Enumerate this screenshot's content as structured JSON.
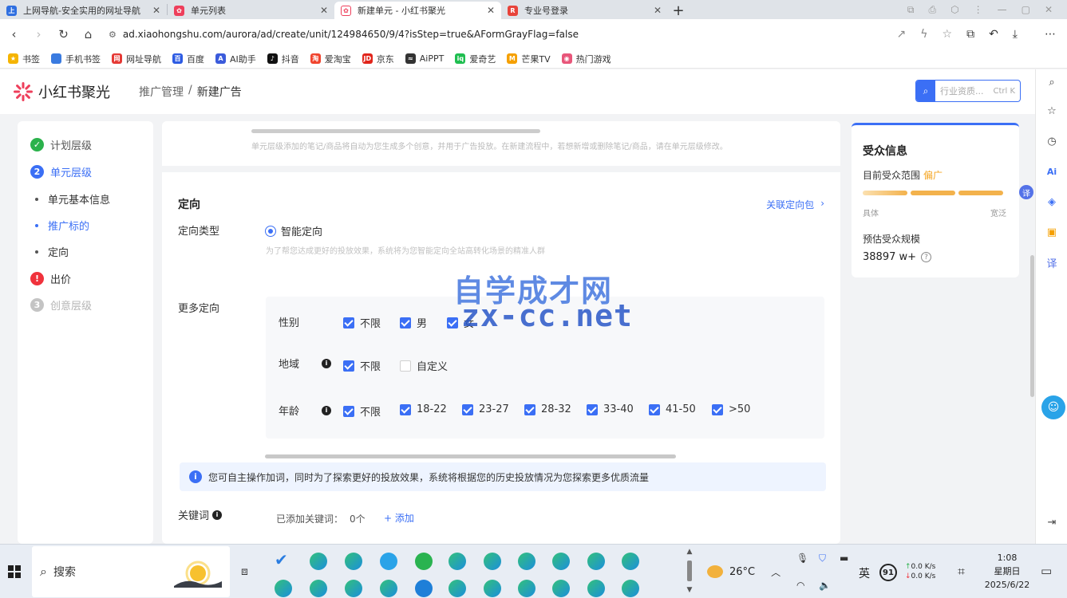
{
  "browser": {
    "tabs": [
      {
        "title": "上网导航-安全实用的网址导航",
        "fav_color": "#2f6fe0",
        "active": false
      },
      {
        "title": "单元列表",
        "fav_color": "#ee3f5b",
        "active": false
      },
      {
        "title": "新建单元 - 小红书聚光",
        "fav_color": "#ee3f5b",
        "active": true
      },
      {
        "title": "专业号登录",
        "fav_color": "#e8433a",
        "active": false
      }
    ],
    "url": "ad.xiaohongshu.com/aurora/ad/create/unit/124984650/9/4?isStep=true&AFormGrayFlag=false",
    "bookmarks": [
      {
        "label": "书签",
        "color": "#f5b400"
      },
      {
        "label": "手机书签",
        "color": "#3a7be0"
      },
      {
        "label": "网址导航",
        "color": "#e53935"
      },
      {
        "label": "百度",
        "color": "#2d5be3"
      },
      {
        "label": "AI助手",
        "color": "#3b5bdb"
      },
      {
        "label": "抖音",
        "color": "#111111"
      },
      {
        "label": "爱淘宝",
        "color": "#f0442e"
      },
      {
        "label": "京东",
        "color": "#e1251b"
      },
      {
        "label": "AiPPT",
        "color": "#333333"
      },
      {
        "label": "爱奇艺",
        "color": "#1fbe50"
      },
      {
        "label": "芒果TV",
        "color": "#f5a000"
      },
      {
        "label": "热门游戏",
        "color": "#e8567a"
      }
    ]
  },
  "app": {
    "brand": "小红书聚光",
    "breadcrumb": {
      "parent": "推广管理",
      "sep": "/",
      "current": "新建广告"
    },
    "search": {
      "placeholder": "行业资质...",
      "shortcut": "Ctrl K"
    }
  },
  "steps": {
    "plan": {
      "label": "计划层级",
      "status": "done"
    },
    "unit": {
      "label": "单元层级",
      "number": "2"
    },
    "sub_items": [
      "单元基本信息",
      "推广标的",
      "定向"
    ],
    "bid": {
      "label": "出价",
      "status": "error"
    },
    "creative": {
      "label": "创意层级",
      "number": "3"
    }
  },
  "top_note": "单元层级添加的笔记/商品将自动为您生成多个创意，并用于广告投放。在新建流程中，若想新增或删除笔记/商品，请在单元层级修改。",
  "targeting": {
    "title": "定向",
    "link_label": "关联定向包",
    "type_label": "定向类型",
    "type_value": "智能定向",
    "type_hint": "为了帮您达成更好的投放效果，系统将为您智能定向全站高转化场景的精准人群",
    "more_label": "更多定向",
    "gender": {
      "label": "性别",
      "options": [
        "不限",
        "男",
        "女"
      ]
    },
    "region": {
      "label": "地域",
      "options": [
        "不限",
        "自定义"
      ]
    },
    "age": {
      "label": "年龄",
      "options": [
        "不限",
        "18-22",
        "23-27",
        "28-32",
        "33-40",
        "41-50",
        ">50"
      ]
    }
  },
  "notice": "您可自主操作加词，同时为了探索更好的投放效果，系统将根据您的历史投放情况为您探索更多优质流量",
  "keywords": {
    "label": "关键词",
    "added_label": "已添加关键词：",
    "count": "0个",
    "add_label": "+ 添加"
  },
  "audience": {
    "title": "受众信息",
    "range_label": "目前受众范围",
    "range_value": "偏广",
    "gauge_left": "具体",
    "gauge_right": "宽泛",
    "size_label": "预估受众规模",
    "size_value": "38897 w+"
  },
  "watermark": {
    "line1": "自学成才网",
    "line2": "zx-cc.net"
  },
  "taskbar": {
    "search_label": "搜索",
    "weather": "26°C",
    "ime": "英",
    "battery": "91",
    "net_up": "0.0 K/s",
    "net_down": "0.0 K/s",
    "time": "1:08",
    "weekday": "星期日",
    "date": "2025/6/22"
  },
  "colors": {
    "primary": "#3b6ff5",
    "success": "#2bb24c",
    "error": "#f0323c",
    "warn": "#f5a623"
  }
}
